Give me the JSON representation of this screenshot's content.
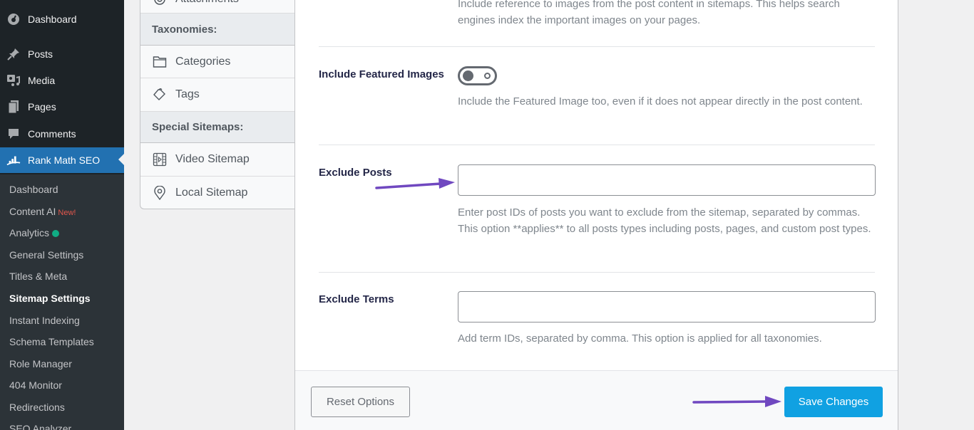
{
  "admin_menu": {
    "items": [
      {
        "label": "Dashboard",
        "icon": "dashboard-icon"
      },
      {
        "label": "Posts",
        "icon": "pin-icon"
      },
      {
        "label": "Media",
        "icon": "media-icon"
      },
      {
        "label": "Pages",
        "icon": "pages-icon"
      },
      {
        "label": "Comments",
        "icon": "comment-icon"
      },
      {
        "label": "Rank Math SEO",
        "icon": "rank-math-icon",
        "current": true
      }
    ],
    "submenu": [
      {
        "label": "Dashboard"
      },
      {
        "label": "Content AI",
        "badge": "New!"
      },
      {
        "label": "Analytics",
        "status_dot_color": "#10ac84"
      },
      {
        "label": "General Settings"
      },
      {
        "label": "Titles & Meta"
      },
      {
        "label": "Sitemap Settings",
        "current": true
      },
      {
        "label": "Instant Indexing"
      },
      {
        "label": "Schema Templates"
      },
      {
        "label": "Role Manager"
      },
      {
        "label": "404 Monitor"
      },
      {
        "label": "Redirections"
      },
      {
        "label": "SEO Analyzer"
      }
    ]
  },
  "settings_nav": {
    "partial_item": "Attachments",
    "taxonomies_heading": "Taxonomies:",
    "taxonomies": [
      {
        "label": "Categories",
        "icon": "folder-icon"
      },
      {
        "label": "Tags",
        "icon": "tag-icon"
      }
    ],
    "special_heading": "Special Sitemaps:",
    "special": [
      {
        "label": "Video Sitemap",
        "icon": "film-icon"
      },
      {
        "label": "Local Sitemap",
        "icon": "location-pin-icon"
      }
    ]
  },
  "main": {
    "images_desc": "Include reference to images from the post content in sitemaps. This helps search engines index the important images on your pages.",
    "featured": {
      "label": "Include Featured Images",
      "toggle_on": false,
      "desc": "Include the Featured Image too, even if it does not appear directly in the post content."
    },
    "exclude_posts": {
      "label": "Exclude Posts",
      "value": "",
      "desc": "Enter post IDs of posts you want to exclude from the sitemap, separated by commas. This option **applies** to all posts types including posts, pages, and custom post types."
    },
    "exclude_terms": {
      "label": "Exclude Terms",
      "value": "",
      "desc": "Add term IDs, separated by comma. This option is applied for all taxonomies."
    }
  },
  "footer": {
    "reset_label": "Reset Options",
    "save_label": "Save Changes"
  },
  "colors": {
    "accent": "#2271b1",
    "save_button": "#10a1e2",
    "annotation_arrow": "#7048c0"
  }
}
